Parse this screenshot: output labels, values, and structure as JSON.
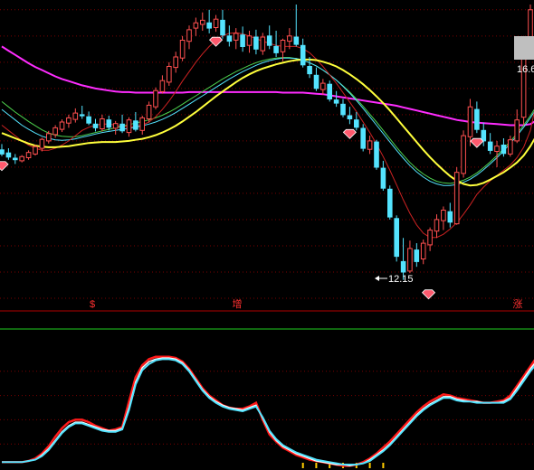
{
  "chart_data": [
    {
      "type": "candlestick",
      "panel": "price",
      "title": "",
      "xlabel": "",
      "ylabel": "",
      "ylim": [
        11.8,
        17.4
      ],
      "grid": true,
      "price_label": "16.6",
      "low_marker_label": "12.15",
      "signal_labels": [
        "$",
        "增",
        "涨"
      ],
      "colors": {
        "background": "#000000",
        "grid": "#7a0000",
        "up_candle": "#ff5050",
        "down_candle": "#54e4ff",
        "ma_long": "#ff2cff",
        "ma_mid": "#ffff3c",
        "ma_fast": "#cc2222",
        "ma_green": "#4dd14d",
        "ma_cyan": "#54e4ff",
        "diamond": "#ff5a6e"
      },
      "candles": [
        {
          "o": 14.63,
          "h": 14.74,
          "l": 14.51,
          "c": 14.55
        },
        {
          "o": 14.57,
          "h": 14.66,
          "l": 14.44,
          "c": 14.49
        },
        {
          "o": 14.47,
          "h": 14.55,
          "l": 14.36,
          "c": 14.44
        },
        {
          "o": 14.42,
          "h": 14.53,
          "l": 14.39,
          "c": 14.5
        },
        {
          "o": 14.48,
          "h": 14.62,
          "l": 14.44,
          "c": 14.58
        },
        {
          "o": 14.55,
          "h": 14.73,
          "l": 14.52,
          "c": 14.69
        },
        {
          "o": 14.66,
          "h": 14.86,
          "l": 14.6,
          "c": 14.83
        },
        {
          "o": 14.8,
          "h": 14.99,
          "l": 14.75,
          "c": 14.94
        },
        {
          "o": 14.92,
          "h": 15.1,
          "l": 14.86,
          "c": 15.05
        },
        {
          "o": 15.02,
          "h": 15.21,
          "l": 14.97,
          "c": 15.16
        },
        {
          "o": 15.14,
          "h": 15.3,
          "l": 15.05,
          "c": 15.24
        },
        {
          "o": 15.21,
          "h": 15.42,
          "l": 15.15,
          "c": 15.33
        },
        {
          "o": 15.3,
          "h": 15.47,
          "l": 15.22,
          "c": 15.28
        },
        {
          "o": 15.26,
          "h": 15.36,
          "l": 15.1,
          "c": 15.14
        },
        {
          "o": 15.12,
          "h": 15.22,
          "l": 14.98,
          "c": 15.05
        },
        {
          "o": 15.03,
          "h": 15.3,
          "l": 14.98,
          "c": 15.22
        },
        {
          "o": 15.2,
          "h": 15.28,
          "l": 15.0,
          "c": 15.06
        },
        {
          "o": 15.04,
          "h": 15.18,
          "l": 14.92,
          "c": 15.13
        },
        {
          "o": 15.12,
          "h": 15.3,
          "l": 14.95,
          "c": 14.99
        },
        {
          "o": 14.96,
          "h": 15.25,
          "l": 14.88,
          "c": 15.2
        },
        {
          "o": 15.18,
          "h": 15.35,
          "l": 14.98,
          "c": 15.02
        },
        {
          "o": 15.0,
          "h": 15.28,
          "l": 14.92,
          "c": 15.24
        },
        {
          "o": 15.22,
          "h": 15.55,
          "l": 15.15,
          "c": 15.48
        },
        {
          "o": 15.45,
          "h": 15.82,
          "l": 15.4,
          "c": 15.76
        },
        {
          "o": 15.74,
          "h": 16.05,
          "l": 15.7,
          "c": 15.95
        },
        {
          "o": 15.92,
          "h": 16.3,
          "l": 15.85,
          "c": 16.22
        },
        {
          "o": 16.2,
          "h": 16.5,
          "l": 16.1,
          "c": 16.4
        },
        {
          "o": 16.38,
          "h": 16.8,
          "l": 16.32,
          "c": 16.72
        },
        {
          "o": 16.7,
          "h": 17.0,
          "l": 16.55,
          "c": 16.92
        },
        {
          "o": 16.95,
          "h": 17.15,
          "l": 16.8,
          "c": 17.05
        },
        {
          "o": 17.02,
          "h": 17.25,
          "l": 16.9,
          "c": 17.1
        },
        {
          "o": 17.05,
          "h": 17.3,
          "l": 16.85,
          "c": 16.95
        },
        {
          "o": 16.96,
          "h": 17.2,
          "l": 16.88,
          "c": 17.12
        },
        {
          "o": 17.1,
          "h": 17.3,
          "l": 16.75,
          "c": 16.82
        },
        {
          "o": 16.8,
          "h": 17.0,
          "l": 16.6,
          "c": 16.7
        },
        {
          "o": 16.72,
          "h": 16.95,
          "l": 16.55,
          "c": 16.85
        },
        {
          "o": 16.82,
          "h": 16.98,
          "l": 16.5,
          "c": 16.6
        },
        {
          "o": 16.62,
          "h": 16.9,
          "l": 16.48,
          "c": 16.8
        },
        {
          "o": 16.78,
          "h": 16.92,
          "l": 16.45,
          "c": 16.55
        },
        {
          "o": 16.52,
          "h": 16.86,
          "l": 16.44,
          "c": 16.78
        },
        {
          "o": 16.8,
          "h": 17.0,
          "l": 16.55,
          "c": 16.62
        },
        {
          "o": 16.6,
          "h": 16.9,
          "l": 16.4,
          "c": 16.48
        },
        {
          "o": 16.5,
          "h": 16.75,
          "l": 16.32,
          "c": 16.72
        },
        {
          "o": 16.7,
          "h": 16.95,
          "l": 16.55,
          "c": 16.8
        },
        {
          "o": 16.78,
          "h": 17.4,
          "l": 16.6,
          "c": 16.64
        },
        {
          "o": 16.62,
          "h": 16.75,
          "l": 16.2,
          "c": 16.25
        },
        {
          "o": 16.22,
          "h": 16.4,
          "l": 16.0,
          "c": 16.08
        },
        {
          "o": 16.05,
          "h": 16.2,
          "l": 15.75,
          "c": 15.8
        },
        {
          "o": 15.78,
          "h": 15.98,
          "l": 15.68,
          "c": 15.9
        },
        {
          "o": 15.88,
          "h": 15.95,
          "l": 15.55,
          "c": 15.6
        },
        {
          "o": 15.58,
          "h": 15.75,
          "l": 15.45,
          "c": 15.52
        },
        {
          "o": 15.5,
          "h": 15.6,
          "l": 15.25,
          "c": 15.3
        },
        {
          "o": 15.28,
          "h": 15.45,
          "l": 15.12,
          "c": 15.22
        },
        {
          "o": 15.2,
          "h": 15.35,
          "l": 15.0,
          "c": 15.06
        },
        {
          "o": 15.04,
          "h": 15.12,
          "l": 14.6,
          "c": 14.66
        },
        {
          "o": 14.64,
          "h": 14.9,
          "l": 14.55,
          "c": 14.8
        },
        {
          "o": 14.78,
          "h": 14.82,
          "l": 14.25,
          "c": 14.3
        },
        {
          "o": 14.28,
          "h": 14.42,
          "l": 13.85,
          "c": 13.9
        },
        {
          "o": 13.88,
          "h": 13.95,
          "l": 13.3,
          "c": 13.35
        },
        {
          "o": 13.32,
          "h": 13.38,
          "l": 12.5,
          "c": 12.6
        },
        {
          "o": 12.5,
          "h": 12.95,
          "l": 12.15,
          "c": 12.3
        },
        {
          "o": 12.32,
          "h": 12.9,
          "l": 12.28,
          "c": 12.75
        },
        {
          "o": 12.72,
          "h": 12.85,
          "l": 12.4,
          "c": 12.5
        },
        {
          "o": 12.55,
          "h": 12.92,
          "l": 12.45,
          "c": 12.85
        },
        {
          "o": 12.82,
          "h": 13.15,
          "l": 12.7,
          "c": 13.1
        },
        {
          "o": 13.08,
          "h": 13.4,
          "l": 12.95,
          "c": 13.3
        },
        {
          "o": 13.28,
          "h": 13.55,
          "l": 13.1,
          "c": 13.48
        },
        {
          "o": 13.45,
          "h": 13.62,
          "l": 13.15,
          "c": 13.25
        },
        {
          "o": 13.22,
          "h": 14.3,
          "l": 13.2,
          "c": 14.2
        },
        {
          "o": 14.18,
          "h": 15.0,
          "l": 14.1,
          "c": 14.9
        },
        {
          "o": 14.88,
          "h": 15.6,
          "l": 14.7,
          "c": 15.45
        },
        {
          "o": 15.4,
          "h": 15.55,
          "l": 14.95,
          "c": 15.02
        },
        {
          "o": 15.0,
          "h": 15.15,
          "l": 14.7,
          "c": 14.8
        },
        {
          "o": 14.78,
          "h": 14.95,
          "l": 14.55,
          "c": 14.62
        },
        {
          "o": 14.6,
          "h": 14.8,
          "l": 14.3,
          "c": 14.7
        },
        {
          "o": 14.72,
          "h": 14.85,
          "l": 14.5,
          "c": 14.56
        },
        {
          "o": 14.55,
          "h": 14.9,
          "l": 14.5,
          "c": 14.82
        },
        {
          "o": 14.8,
          "h": 15.4,
          "l": 14.76,
          "c": 15.2
        },
        {
          "o": 15.25,
          "h": 16.8,
          "l": 15.1,
          "c": 16.6
        },
        {
          "o": 16.6,
          "h": 17.4,
          "l": 16.4,
          "c": 17.3
        }
      ],
      "ma_long": [
        16.6,
        16.52,
        16.44,
        16.36,
        16.28,
        16.21,
        16.15,
        16.09,
        16.03,
        15.98,
        15.94,
        15.9,
        15.86,
        15.83,
        15.8,
        15.78,
        15.76,
        15.74,
        15.73,
        15.73,
        15.72,
        15.72,
        15.72,
        15.72,
        15.72,
        15.72,
        15.72,
        15.72,
        15.73,
        15.73,
        15.73,
        15.73,
        15.73,
        15.73,
        15.73,
        15.73,
        15.73,
        15.73,
        15.73,
        15.73,
        15.73,
        15.73,
        15.72,
        15.72,
        15.72,
        15.72,
        15.71,
        15.7,
        15.69,
        15.67,
        15.65,
        15.63,
        15.61,
        15.59,
        15.57,
        15.55,
        15.53,
        15.51,
        15.49,
        15.47,
        15.44,
        15.41,
        15.38,
        15.35,
        15.32,
        15.29,
        15.26,
        15.23,
        15.2,
        15.18,
        15.16,
        15.15,
        15.14,
        15.13,
        15.12,
        15.11,
        15.1,
        15.1,
        15.1,
        15.12,
        15.2
      ],
      "ma_mid": [
        14.95,
        14.9,
        14.85,
        14.8,
        14.75,
        14.71,
        14.69,
        14.68,
        14.68,
        14.69,
        14.7,
        14.72,
        14.74,
        14.76,
        14.77,
        14.78,
        14.78,
        14.78,
        14.79,
        14.8,
        14.82,
        14.84,
        14.87,
        14.91,
        14.96,
        15.02,
        15.09,
        15.17,
        15.26,
        15.35,
        15.45,
        15.55,
        15.65,
        15.74,
        15.83,
        15.92,
        16.0,
        16.07,
        16.13,
        16.18,
        16.22,
        16.26,
        16.29,
        16.32,
        16.34,
        16.35,
        16.35,
        16.34,
        16.31,
        16.27,
        16.22,
        16.15,
        16.07,
        15.98,
        15.88,
        15.77,
        15.65,
        15.52,
        15.38,
        15.23,
        15.08,
        14.93,
        14.78,
        14.63,
        14.49,
        14.36,
        14.24,
        14.13,
        14.04,
        13.98,
        13.95,
        13.96,
        14.0,
        14.06,
        14.13,
        14.2,
        14.29,
        14.39,
        14.52,
        14.7,
        14.92
      ],
      "ma_green": [
        15.55,
        15.45,
        15.35,
        15.26,
        15.17,
        15.09,
        15.01,
        14.95,
        14.91,
        14.89,
        14.88,
        14.88,
        14.9,
        14.93,
        14.96,
        14.99,
        15.02,
        15.05,
        15.08,
        15.11,
        15.14,
        15.17,
        15.2,
        15.24,
        15.29,
        15.35,
        15.42,
        15.5,
        15.58,
        15.66,
        15.74,
        15.82,
        15.9,
        15.98,
        16.05,
        16.12,
        16.18,
        16.24,
        16.29,
        16.33,
        16.36,
        16.38,
        16.39,
        16.39,
        16.37,
        16.34,
        16.29,
        16.23,
        16.15,
        16.06,
        15.96,
        15.85,
        15.73,
        15.6,
        15.46,
        15.31,
        15.16,
        15.0,
        14.84,
        14.68,
        14.53,
        14.39,
        14.27,
        14.17,
        14.09,
        14.03,
        14.0,
        13.99,
        14.01,
        14.05,
        14.11,
        14.19,
        14.29,
        14.4,
        14.52,
        14.65,
        14.79,
        14.94,
        15.1,
        15.28,
        15.48
      ],
      "ma_cyan": [
        15.4,
        15.3,
        15.2,
        15.1,
        15.02,
        14.95,
        14.89,
        14.85,
        14.82,
        14.81,
        14.82,
        14.84,
        14.87,
        14.9,
        14.93,
        14.96,
        14.98,
        15.0,
        15.02,
        15.04,
        15.06,
        15.09,
        15.12,
        15.16,
        15.21,
        15.27,
        15.34,
        15.42,
        15.5,
        15.58,
        15.66,
        15.74,
        15.82,
        15.9,
        15.98,
        16.05,
        16.12,
        16.18,
        16.24,
        16.29,
        16.33,
        16.36,
        16.38,
        16.38,
        16.37,
        16.34,
        16.29,
        16.23,
        16.15,
        16.06,
        15.96,
        15.84,
        15.71,
        15.57,
        15.42,
        15.26,
        15.1,
        14.94,
        14.78,
        14.62,
        14.47,
        14.33,
        14.21,
        14.11,
        14.03,
        13.98,
        13.95,
        13.95,
        13.97,
        14.01,
        14.07,
        14.15,
        14.25,
        14.36,
        14.48,
        14.61,
        14.75,
        14.9,
        15.06,
        15.24,
        15.44
      ],
      "ma_fast": [
        15.1,
        15.0,
        14.9,
        14.8,
        14.72,
        14.66,
        14.62,
        14.62,
        14.66,
        14.72,
        14.8,
        14.9,
        15.0,
        15.06,
        15.1,
        15.12,
        15.12,
        15.1,
        15.08,
        15.07,
        15.08,
        15.1,
        15.16,
        15.26,
        15.4,
        15.56,
        15.74,
        15.94,
        16.12,
        16.3,
        16.46,
        16.6,
        16.72,
        16.8,
        16.85,
        16.86,
        16.84,
        16.8,
        16.75,
        16.7,
        16.66,
        16.62,
        16.6,
        16.6,
        16.6,
        16.56,
        16.48,
        16.36,
        16.22,
        16.06,
        15.9,
        15.72,
        15.54,
        15.36,
        15.16,
        14.96,
        14.74,
        14.5,
        14.24,
        13.96,
        13.68,
        13.42,
        13.2,
        13.04,
        12.96,
        12.96,
        13.02,
        13.12,
        13.24,
        13.4,
        13.58,
        13.78,
        13.92,
        14.04,
        14.14,
        14.24,
        14.34,
        14.48,
        14.68,
        15.0,
        15.6
      ],
      "signal_diamonds_at": [
        0,
        32,
        52,
        71
      ],
      "low_marker_at": 60
    },
    {
      "type": "line",
      "panel": "oscillator",
      "title": "",
      "xlabel": "",
      "ylabel": "",
      "ylim": [
        0,
        100
      ],
      "grid": true,
      "volume_bars_at": [
        45,
        47,
        49,
        51,
        53,
        55,
        57
      ],
      "series": [
        {
          "color": "#ff1a1a",
          "values": [
            5,
            5,
            5,
            5,
            6,
            8,
            12,
            18,
            26,
            33,
            38,
            40,
            40,
            38,
            35,
            33,
            31,
            32,
            34,
            55,
            75,
            85,
            90,
            92,
            92,
            92,
            91,
            88,
            82,
            74,
            66,
            60,
            56,
            52,
            50,
            49,
            49,
            51,
            54,
            40,
            28,
            22,
            17,
            14,
            11,
            9,
            7,
            6,
            5,
            4,
            3,
            2,
            2,
            3,
            5,
            8,
            12,
            17,
            22,
            28,
            34,
            40,
            46,
            51,
            55,
            58,
            61,
            60,
            58,
            57,
            56,
            55,
            54,
            54,
            55,
            56,
            60,
            68,
            76,
            84,
            92,
            96
          ]
        },
        {
          "color": "#ffffff",
          "values": [
            5,
            5,
            5,
            5,
            6,
            7,
            11,
            16,
            23,
            30,
            35,
            38,
            38,
            36,
            34,
            32,
            31,
            31,
            33,
            50,
            71,
            83,
            88,
            90,
            91,
            91,
            90,
            87,
            81,
            73,
            65,
            59,
            55,
            52,
            50,
            49,
            48,
            50,
            52,
            41,
            30,
            23,
            18,
            15,
            12,
            10,
            8,
            6,
            5,
            4,
            3,
            3,
            2,
            3,
            4,
            7,
            11,
            15,
            20,
            26,
            32,
            38,
            44,
            49,
            53,
            56,
            59,
            59,
            57,
            56,
            55,
            55,
            54,
            54,
            54,
            55,
            58,
            66,
            74,
            82,
            89,
            93
          ]
        },
        {
          "color": "#54e4ff",
          "values": [
            5,
            5,
            5,
            5,
            6,
            7,
            10,
            15,
            22,
            29,
            34,
            37,
            37,
            35,
            33,
            31,
            30,
            30,
            32,
            48,
            69,
            81,
            86,
            89,
            90,
            90,
            89,
            86,
            80,
            72,
            64,
            58,
            54,
            51,
            49,
            48,
            47,
            49,
            51,
            42,
            31,
            24,
            19,
            16,
            13,
            11,
            9,
            7,
            6,
            5,
            4,
            3,
            3,
            3,
            4,
            6,
            10,
            14,
            19,
            25,
            31,
            37,
            43,
            48,
            52,
            55,
            58,
            58,
            56,
            55,
            55,
            54,
            54,
            54,
            54,
            54,
            57,
            64,
            72,
            80,
            87,
            91
          ]
        }
      ]
    }
  ]
}
